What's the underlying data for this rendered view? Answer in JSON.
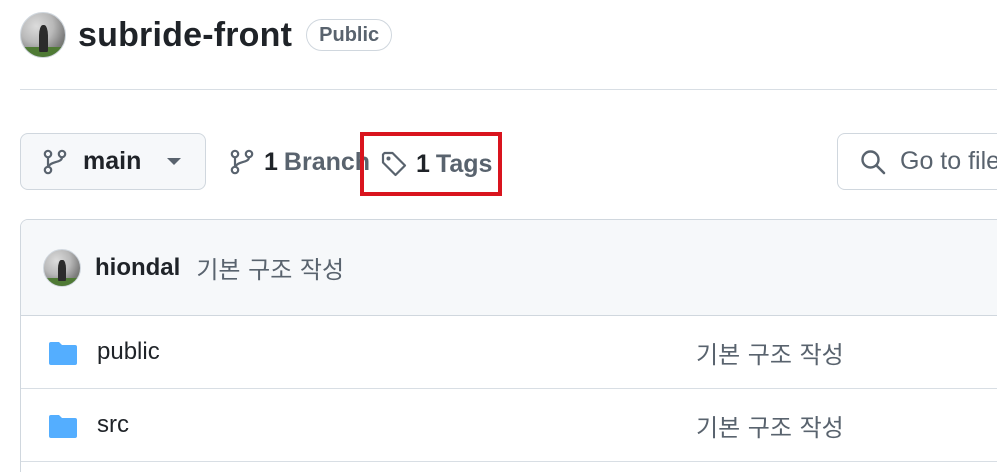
{
  "repo": {
    "name": "subride-front",
    "visibility": "Public"
  },
  "toolbar": {
    "branch_name": "main",
    "branches_count": "1",
    "branches_label": "Branch",
    "tags_count": "1",
    "tags_label": "Tags",
    "search_placeholder": "Go to file"
  },
  "latest_commit": {
    "author": "hiondal",
    "message": "기본 구조 작성"
  },
  "files": [
    {
      "name": "public",
      "type": "folder",
      "commit_message": "기본 구조 작성"
    },
    {
      "name": "src",
      "type": "folder",
      "commit_message": "기본 구조 작성"
    }
  ],
  "colors": {
    "highlight": "#d9141e",
    "folder": "#54aeff",
    "muted_text": "#59636e",
    "border": "#d0d7de"
  }
}
